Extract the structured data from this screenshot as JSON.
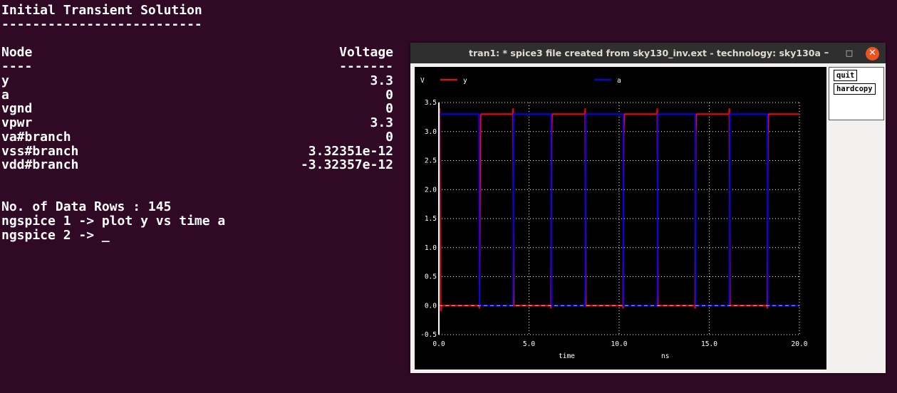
{
  "terminal": {
    "title": "Initial Transient Solution",
    "title_rule": "--------------------------",
    "header_node": "Node",
    "header_voltage": "Voltage",
    "rule_node": "----",
    "rule_voltage": "-------",
    "rows": [
      {
        "node": "y",
        "value": "3.3"
      },
      {
        "node": "a",
        "value": "0"
      },
      {
        "node": "vgnd",
        "value": "0"
      },
      {
        "node": "vpwr",
        "value": "3.3"
      },
      {
        "node": "va#branch",
        "value": "0"
      },
      {
        "node": "vss#branch",
        "value": "3.32351e-12"
      },
      {
        "node": "vdd#branch",
        "value": "-3.32357e-12"
      }
    ],
    "rows_line": "No. of Data Rows : 145",
    "cmd1": "ngspice 1 -> plot y vs time a",
    "cmd2": "ngspice 2 -> _"
  },
  "window": {
    "title": "tran1: * spice3 file created from sky130_inv.ext - technology: sky130a",
    "minimize": "–",
    "maximize": "□",
    "close": "✕",
    "buttons": {
      "quit": "quit",
      "hardcopy": "hardcopy"
    }
  },
  "colors": {
    "y": "#ff0000",
    "a": "#0000ff",
    "grid": "#ffffff",
    "background": "#000000"
  },
  "chart_data": {
    "type": "line",
    "ylabel": "V",
    "xlabel": "time",
    "xunit": "ns",
    "xlim": [
      0,
      20
    ],
    "ylim": [
      -0.5,
      3.5
    ],
    "xticks": [
      "0.0",
      "5.0",
      "10.0",
      "15.0",
      "20.0"
    ],
    "yticks": [
      "-0.5",
      "0.0",
      "0.5",
      "1.0",
      "1.5",
      "2.0",
      "2.5",
      "3.0",
      "3.5"
    ],
    "grid": true,
    "legend_placement": "top",
    "series": [
      {
        "name": "y",
        "x": [
          0.0,
          0.05,
          0.08,
          0.1,
          0.15,
          2.2,
          2.25,
          2.3,
          2.32,
          2.35,
          2.4,
          4.1,
          4.12,
          4.15,
          4.18,
          6.2,
          6.22,
          6.25,
          6.28,
          6.3,
          6.35,
          8.1,
          8.12,
          8.15,
          8.18,
          10.2,
          10.22,
          10.25,
          10.28,
          10.3,
          10.35,
          12.1,
          12.12,
          12.15,
          12.18,
          14.2,
          14.22,
          14.25,
          14.28,
          14.3,
          14.35,
          16.1,
          16.12,
          16.15,
          16.18,
          18.2,
          18.22,
          18.25,
          18.28,
          18.3,
          18.35,
          20.0
        ],
        "y": [
          3.3,
          3.4,
          1.0,
          -0.1,
          0.0,
          0.0,
          -0.05,
          2.8,
          3.28,
          3.3,
          3.3,
          3.3,
          3.4,
          0.0,
          0.0,
          0.0,
          -0.05,
          2.9,
          3.28,
          3.3,
          3.3,
          3.3,
          3.4,
          0.0,
          0.0,
          0.0,
          -0.05,
          2.9,
          3.28,
          3.3,
          3.3,
          3.3,
          3.4,
          0.0,
          0.0,
          0.0,
          -0.05,
          2.9,
          3.28,
          3.3,
          3.3,
          3.3,
          3.4,
          0.0,
          0.0,
          0.0,
          -0.05,
          2.9,
          3.28,
          3.3,
          3.3,
          3.3
        ]
      },
      {
        "name": "a",
        "x": [
          0.0,
          0.02,
          0.05,
          2.2,
          2.22,
          2.25,
          4.1,
          4.12,
          4.15,
          6.2,
          6.22,
          6.25,
          8.1,
          8.12,
          8.15,
          10.2,
          10.22,
          10.25,
          12.1,
          12.12,
          12.15,
          14.2,
          14.22,
          14.25,
          16.1,
          16.12,
          16.15,
          18.2,
          18.22,
          18.25,
          20.0
        ],
        "y": [
          0.0,
          3.3,
          3.3,
          3.3,
          3.3,
          0.0,
          0.0,
          0.2,
          3.3,
          3.3,
          3.3,
          0.0,
          0.0,
          0.2,
          3.3,
          3.3,
          3.3,
          0.0,
          0.0,
          0.2,
          3.3,
          3.3,
          3.3,
          0.0,
          0.0,
          0.2,
          3.3,
          3.3,
          3.3,
          0.0,
          0.0
        ]
      }
    ]
  }
}
